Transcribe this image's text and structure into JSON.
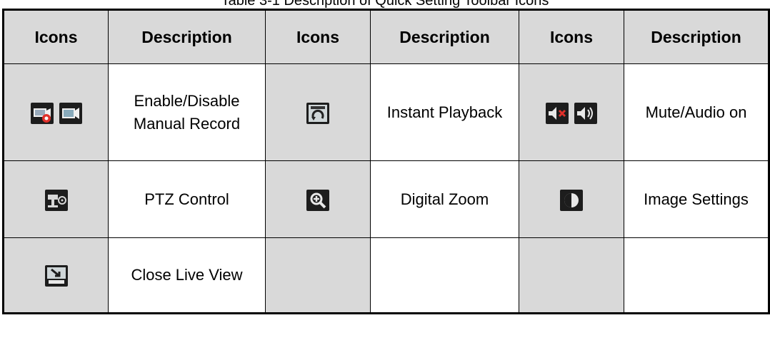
{
  "caption": "Table 3-1 Description of Quick Setting Toolbar Icons",
  "headers": [
    "Icons",
    "Description",
    "Icons",
    "Description",
    "Icons",
    "Description"
  ],
  "rows": [
    {
      "c1_icons": [
        "record-enable-icon",
        "record-disable-icon"
      ],
      "c1_desc": "Enable/Disable Manual Record",
      "c2_icons": [
        "instant-playback-icon"
      ],
      "c2_desc": "Instant Playback",
      "c3_icons": [
        "mute-icon",
        "audio-on-icon"
      ],
      "c3_desc": "Mute/Audio on"
    },
    {
      "c1_icons": [
        "ptz-control-icon"
      ],
      "c1_desc": "PTZ Control",
      "c2_icons": [
        "digital-zoom-icon"
      ],
      "c2_desc": "Digital Zoom",
      "c3_icons": [
        "image-settings-icon"
      ],
      "c3_desc": "Image Settings"
    },
    {
      "c1_icons": [
        "close-live-view-icon"
      ],
      "c1_desc": "Close Live View",
      "c2_icons": [],
      "c2_desc": "",
      "c3_icons": [],
      "c3_desc": ""
    }
  ],
  "colors": {
    "header_bg": "#d9d9d9",
    "icon_cell_bg": "#d9d9d9",
    "border": "#000000",
    "record_red": "#e0302a"
  }
}
